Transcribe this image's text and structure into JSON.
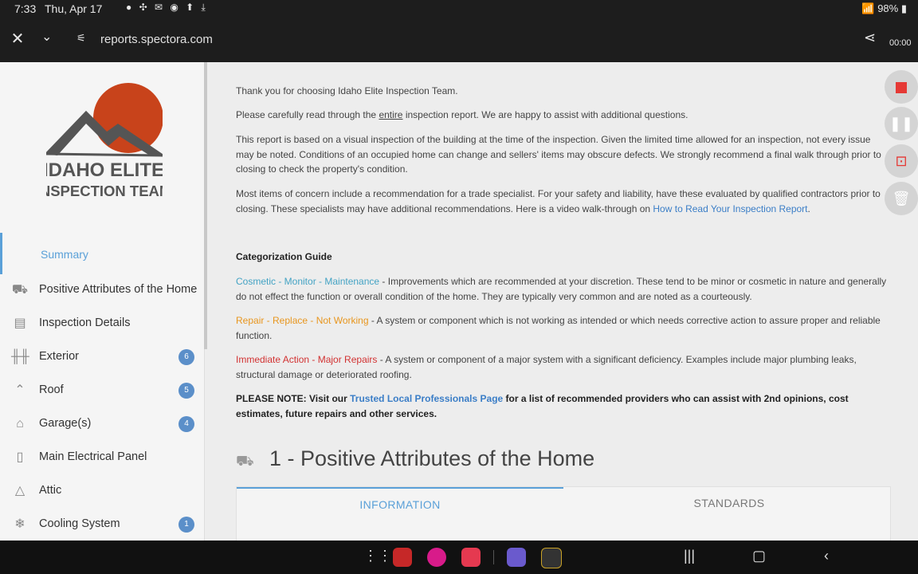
{
  "status": {
    "time": "7:33",
    "date": "Thu, Apr 17",
    "icons": "● ✣ ✉ ◉ ⬆ ⤓",
    "right": "📶 98% ▮"
  },
  "browser": {
    "url": "reports.spectora.com",
    "timer": "00:00"
  },
  "logo": {
    "line1": "IDAHO ELITE",
    "line2": "INSPECTION TEAM"
  },
  "sidebar": {
    "summary": "Summary",
    "items": [
      {
        "label": "Positive Attributes of the Home",
        "icon": "house-icon",
        "badge": ""
      },
      {
        "label": "Inspection Details",
        "icon": "clipboard-icon",
        "badge": ""
      },
      {
        "label": "Exterior",
        "icon": "fence-icon",
        "badge": "6"
      },
      {
        "label": "Roof",
        "icon": "roof-icon",
        "badge": "5"
      },
      {
        "label": "Garage(s)",
        "icon": "garage-icon",
        "badge": "4"
      },
      {
        "label": "Main Electrical Panel",
        "icon": "panel-icon",
        "badge": ""
      },
      {
        "label": "Attic",
        "icon": "attic-icon",
        "badge": ""
      },
      {
        "label": "Cooling System",
        "icon": "snowflake-icon",
        "badge": "1"
      }
    ]
  },
  "intro": {
    "thanks": "Thank you for choosing Idaho Elite Inspection Team.",
    "read_pre": "Please carefully read through the ",
    "read_ul": "entire",
    "read_post": " inspection report. We are happy to assist with additional questions.",
    "visual": "This report is based on a visual inspection of the building at the time of the inspection. Given the limited time allowed for an inspection, not every issue may be noted. Conditions of an occupied home can change and sellers' items may obscure defects. We strongly recommend a final walk through prior to closing to check the property's condition.",
    "concern": "Most items of concern include a recommendation for a trade specialist. For your safety and liability, have these evaluated by qualified contractors prior to closing. These specialists may have additional recommendations. Here is a video walk-through on ",
    "concern_link": "How to Read Your Inspection Report",
    "concern_end": "."
  },
  "guide": {
    "title": "Categorization Guide",
    "cosmetic_label": "Cosmetic - Monitor - Maintenance",
    "cosmetic_text": " - Improvements which are recommended at your discretion. These tend to be minor or cosmetic in nature and generally do not effect the function or overall condition of the home. They are typically very common and are noted as a courteously.",
    "repair_label": "Repair - Replace - Not Working",
    "repair_text": " - A system or component which is not working as intended or which needs corrective action to assure proper and reliable function.",
    "immediate_label": "Immediate Action - Major Repairs",
    "immediate_text": "  - A system or component of a major system with a significant deficiency. Examples include major plumbing leaks, structural damage or deteriorated roofing.",
    "note_pre": "PLEASE NOTE: Visit our ",
    "note_link": "Trusted Local Professionals Page",
    "note_post": " for a list of recommended providers who can assist with 2nd opinions, cost estimates, future repairs and other services."
  },
  "section": {
    "title": "1 - Positive Attributes of the Home",
    "tab_info": "INFORMATION",
    "tab_standards": "STANDARDS"
  },
  "colors": {
    "accent": "#5aa0d8",
    "cosmetic": "#44a3c4",
    "repair": "#e8961e",
    "immediate": "#d23232",
    "logo_sun": "#c8431b",
    "logo_mountain": "#555555"
  }
}
